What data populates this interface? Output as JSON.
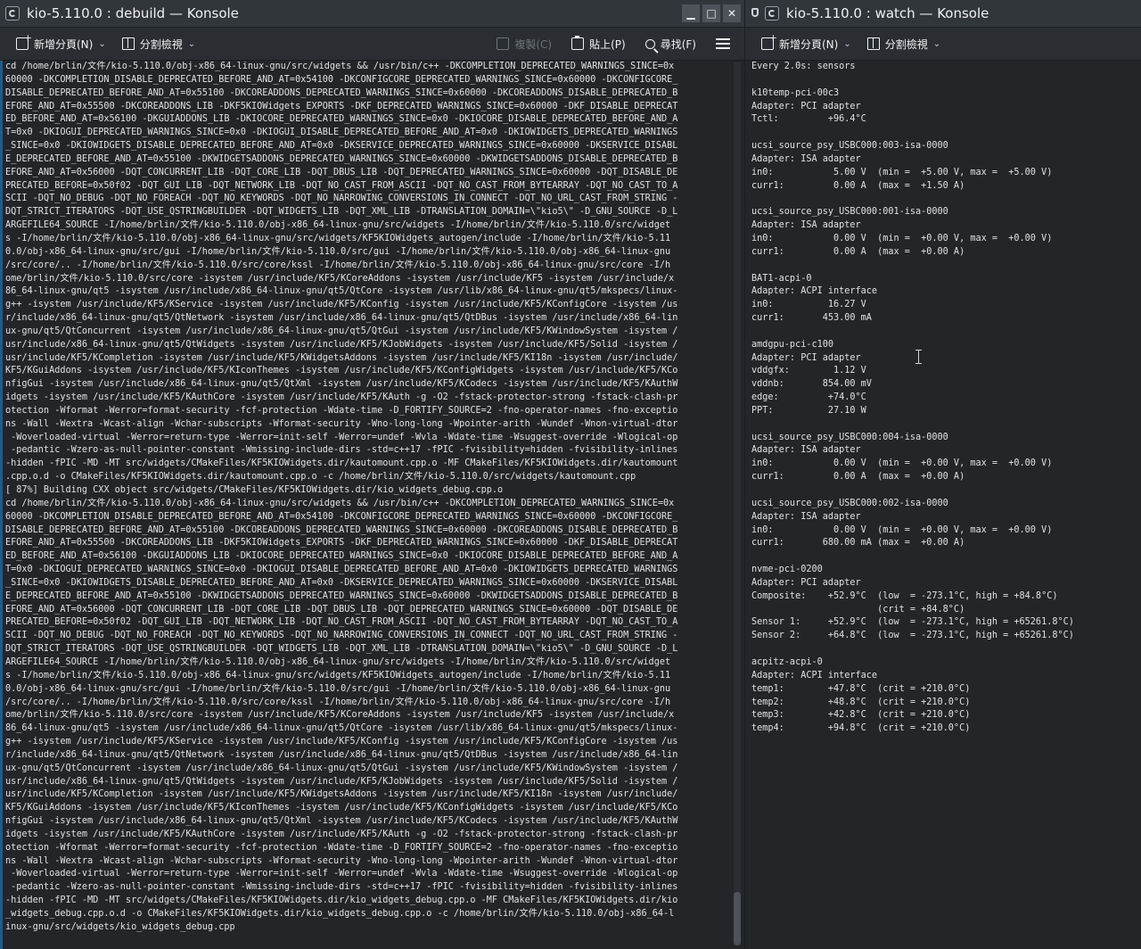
{
  "left_window": {
    "title": "kio-5.110.0 : debuild — Konsole",
    "buttons": {
      "minimize": "▁",
      "maximize": "□",
      "close": "✕"
    },
    "toolbar": {
      "new_tab": "新增分頁(N)",
      "split_view": "分割檢視",
      "copy": "複製(C)",
      "paste": "貼上(P)",
      "find": "尋找(F)"
    },
    "lines": [
      "cd /home/brlin/文件/kio-5.110.0/obj-x86_64-linux-gnu/src/widgets && /usr/bin/c++ -DKCOMPLETION_DEPRECATED_WARNINGS_SINCE=0x",
      "60000 -DKCOMPLETION_DISABLE_DEPRECATED_BEFORE_AND_AT=0x54100 -DKCONFIGCORE_DEPRECATED_WARNINGS_SINCE=0x60000 -DKCONFIGCORE_",
      "DISABLE_DEPRECATED_BEFORE_AND_AT=0x55100 -DKCOREADDONS_DEPRECATED_WARNINGS_SINCE=0x60000 -DKCOREADDONS_DISABLE_DEPRECATED_B",
      "EFORE_AND_AT=0x55500 -DKCOREADDONS_LIB -DKF5KIOWidgets_EXPORTS -DKF_DEPRECATED_WARNINGS_SINCE=0x60000 -DKF_DISABLE_DEPRECAT",
      "ED_BEFORE_AND_AT=0x56100 -DKGUIADDONS_LIB -DKIOCORE_DEPRECATED_WARNINGS_SINCE=0x0 -DKIOCORE_DISABLE_DEPRECATED_BEFORE_AND_A",
      "T=0x0 -DKIOGUI_DEPRECATED_WARNINGS_SINCE=0x0 -DKIOGUI_DISABLE_DEPRECATED_BEFORE_AND_AT=0x0 -DKIOWIDGETS_DEPRECATED_WARNINGS",
      "_SINCE=0x0 -DKIOWIDGETS_DISABLE_DEPRECATED_BEFORE_AND_AT=0x0 -DKSERVICE_DEPRECATED_WARNINGS_SINCE=0x60000 -DKSERVICE_DISABL",
      "E_DEPRECATED_BEFORE_AND_AT=0x55100 -DKWIDGETSADDONS_DEPRECATED_WARNINGS_SINCE=0x60000 -DKWIDGETSADDONS_DISABLE_DEPRECATED_B",
      "EFORE_AND_AT=0x56000 -DQT_CONCURRENT_LIB -DQT_CORE_LIB -DQT_DBUS_LIB -DQT_DEPRECATED_WARNINGS_SINCE=0x60000 -DQT_DISABLE_DE",
      "PRECATED_BEFORE=0x50f02 -DQT_GUI_LIB -DQT_NETWORK_LIB -DQT_NO_CAST_FROM_ASCII -DQT_NO_CAST_FROM_BYTEARRAY -DQT_NO_CAST_TO_A",
      "SCII -DQT_NO_DEBUG -DQT_NO_FOREACH -DQT_NO_KEYWORDS -DQT_NO_NARROWING_CONVERSIONS_IN_CONNECT -DQT_NO_URL_CAST_FROM_STRING -",
      "DQT_STRICT_ITERATORS -DQT_USE_QSTRINGBUILDER -DQT_WIDGETS_LIB -DQT_XML_LIB -DTRANSLATION_DOMAIN=\\\"kio5\\\" -D_GNU_SOURCE -D_L",
      "ARGEFILE64_SOURCE -I/home/brlin/文件/kio-5.110.0/obj-x86_64-linux-gnu/src/widgets -I/home/brlin/文件/kio-5.110.0/src/widget",
      "s -I/home/brlin/文件/kio-5.110.0/obj-x86_64-linux-gnu/src/widgets/KF5KIOWidgets_autogen/include -I/home/brlin/文件/kio-5.11",
      "0.0/obj-x86_64-linux-gnu/src/gui -I/home/brlin/文件/kio-5.110.0/src/gui -I/home/brlin/文件/kio-5.110.0/obj-x86_64-linux-gnu",
      "/src/core/.. -I/home/brlin/文件/kio-5.110.0/src/core/kssl -I/home/brlin/文件/kio-5.110.0/obj-x86_64-linux-gnu/src/core -I/h",
      "ome/brlin/文件/kio-5.110.0/src/core -isystem /usr/include/KF5/KCoreAddons -isystem /usr/include/KF5 -isystem /usr/include/x",
      "86_64-linux-gnu/qt5 -isystem /usr/include/x86_64-linux-gnu/qt5/QtCore -isystem /usr/lib/x86_64-linux-gnu/qt5/mkspecs/linux-",
      "g++ -isystem /usr/include/KF5/KService -isystem /usr/include/KF5/KConfig -isystem /usr/include/KF5/KConfigCore -isystem /us",
      "r/include/x86_64-linux-gnu/qt5/QtNetwork -isystem /usr/include/x86_64-linux-gnu/qt5/QtDBus -isystem /usr/include/x86_64-lin",
      "ux-gnu/qt5/QtConcurrent -isystem /usr/include/x86_64-linux-gnu/qt5/QtGui -isystem /usr/include/KF5/KWindowSystem -isystem /",
      "usr/include/x86_64-linux-gnu/qt5/QtWidgets -isystem /usr/include/KF5/KJobWidgets -isystem /usr/include/KF5/Solid -isystem /",
      "usr/include/KF5/KCompletion -isystem /usr/include/KF5/KWidgetsAddons -isystem /usr/include/KF5/KI18n -isystem /usr/include/",
      "KF5/KGuiAddons -isystem /usr/include/KF5/KIconThemes -isystem /usr/include/KF5/KConfigWidgets -isystem /usr/include/KF5/KCo",
      "nfigGui -isystem /usr/include/x86_64-linux-gnu/qt5/QtXml -isystem /usr/include/KF5/KCodecs -isystem /usr/include/KF5/KAuthW",
      "idgets -isystem /usr/include/KF5/KAuthCore -isystem /usr/include/KF5/KAuth -g -O2 -fstack-protector-strong -fstack-clash-pr",
      "otection -Wformat -Werror=format-security -fcf-protection -Wdate-time -D_FORTIFY_SOURCE=2 -fno-operator-names -fno-exceptio",
      "ns -Wall -Wextra -Wcast-align -Wchar-subscripts -Wformat-security -Wno-long-long -Wpointer-arith -Wundef -Wnon-virtual-dtor",
      " -Woverloaded-virtual -Werror=return-type -Werror=init-self -Werror=undef -Wvla -Wdate-time -Wsuggest-override -Wlogical-op",
      " -pedantic -Wzero-as-null-pointer-constant -Wmissing-include-dirs -std=c++17 -fPIC -fvisibility=hidden -fvisibility-inlines",
      "-hidden -fPIC -MD -MT src/widgets/CMakeFiles/KF5KIOWidgets.dir/kautomount.cpp.o -MF CMakeFiles/KF5KIOWidgets.dir/kautomount",
      ".cpp.o.d -o CMakeFiles/KF5KIOWidgets.dir/kautomount.cpp.o -c /home/brlin/文件/kio-5.110.0/src/widgets/kautomount.cpp",
      "[ 87%] Building CXX object src/widgets/CMakeFiles/KF5KIOWidgets.dir/kio_widgets_debug.cpp.o",
      "cd /home/brlin/文件/kio-5.110.0/obj-x86_64-linux-gnu/src/widgets && /usr/bin/c++ -DKCOMPLETION_DEPRECATED_WARNINGS_SINCE=0x",
      "60000 -DKCOMPLETION_DISABLE_DEPRECATED_BEFORE_AND_AT=0x54100 -DKCONFIGCORE_DEPRECATED_WARNINGS_SINCE=0x60000 -DKCONFIGCORE_",
      "DISABLE_DEPRECATED_BEFORE_AND_AT=0x55100 -DKCOREADDONS_DEPRECATED_WARNINGS_SINCE=0x60000 -DKCOREADDONS_DISABLE_DEPRECATED_B",
      "EFORE_AND_AT=0x55500 -DKCOREADDONS_LIB -DKF5KIOWidgets_EXPORTS -DKF_DEPRECATED_WARNINGS_SINCE=0x60000 -DKF_DISABLE_DEPRECAT",
      "ED_BEFORE_AND_AT=0x56100 -DKGUIADDONS_LIB -DKIOCORE_DEPRECATED_WARNINGS_SINCE=0x0 -DKIOCORE_DISABLE_DEPRECATED_BEFORE_AND_A",
      "T=0x0 -DKIOGUI_DEPRECATED_WARNINGS_SINCE=0x0 -DKIOGUI_DISABLE_DEPRECATED_BEFORE_AND_AT=0x0 -DKIOWIDGETS_DEPRECATED_WARNINGS",
      "_SINCE=0x0 -DKIOWIDGETS_DISABLE_DEPRECATED_BEFORE_AND_AT=0x0 -DKSERVICE_DEPRECATED_WARNINGS_SINCE=0x60000 -DKSERVICE_DISABL",
      "E_DEPRECATED_BEFORE_AND_AT=0x55100 -DKWIDGETSADDONS_DEPRECATED_WARNINGS_SINCE=0x60000 -DKWIDGETSADDONS_DISABLE_DEPRECATED_B",
      "EFORE_AND_AT=0x56000 -DQT_CONCURRENT_LIB -DQT_CORE_LIB -DQT_DBUS_LIB -DQT_DEPRECATED_WARNINGS_SINCE=0x60000 -DQT_DISABLE_DE",
      "PRECATED_BEFORE=0x50f02 -DQT_GUI_LIB -DQT_NETWORK_LIB -DQT_NO_CAST_FROM_ASCII -DQT_NO_CAST_FROM_BYTEARRAY -DQT_NO_CAST_TO_A",
      "SCII -DQT_NO_DEBUG -DQT_NO_FOREACH -DQT_NO_KEYWORDS -DQT_NO_NARROWING_CONVERSIONS_IN_CONNECT -DQT_NO_URL_CAST_FROM_STRING -",
      "DQT_STRICT_ITERATORS -DQT_USE_QSTRINGBUILDER -DQT_WIDGETS_LIB -DQT_XML_LIB -DTRANSLATION_DOMAIN=\\\"kio5\\\" -D_GNU_SOURCE -D_L",
      "ARGEFILE64_SOURCE -I/home/brlin/文件/kio-5.110.0/obj-x86_64-linux-gnu/src/widgets -I/home/brlin/文件/kio-5.110.0/src/widget",
      "s -I/home/brlin/文件/kio-5.110.0/obj-x86_64-linux-gnu/src/widgets/KF5KIOWidgets_autogen/include -I/home/brlin/文件/kio-5.11",
      "0.0/obj-x86_64-linux-gnu/src/gui -I/home/brlin/文件/kio-5.110.0/src/gui -I/home/brlin/文件/kio-5.110.0/obj-x86_64-linux-gnu",
      "/src/core/.. -I/home/brlin/文件/kio-5.110.0/src/core/kssl -I/home/brlin/文件/kio-5.110.0/obj-x86_64-linux-gnu/src/core -I/h",
      "ome/brlin/文件/kio-5.110.0/src/core -isystem /usr/include/KF5/KCoreAddons -isystem /usr/include/KF5 -isystem /usr/include/x",
      "86_64-linux-gnu/qt5 -isystem /usr/include/x86_64-linux-gnu/qt5/QtCore -isystem /usr/lib/x86_64-linux-gnu/qt5/mkspecs/linux-",
      "g++ -isystem /usr/include/KF5/KService -isystem /usr/include/KF5/KConfig -isystem /usr/include/KF5/KConfigCore -isystem /us",
      "r/include/x86_64-linux-gnu/qt5/QtNetwork -isystem /usr/include/x86_64-linux-gnu/qt5/QtDBus -isystem /usr/include/x86_64-lin",
      "ux-gnu/qt5/QtConcurrent -isystem /usr/include/x86_64-linux-gnu/qt5/QtGui -isystem /usr/include/KF5/KWindowSystem -isystem /",
      "usr/include/x86_64-linux-gnu/qt5/QtWidgets -isystem /usr/include/KF5/KJobWidgets -isystem /usr/include/KF5/Solid -isystem /",
      "usr/include/KF5/KCompletion -isystem /usr/include/KF5/KWidgetsAddons -isystem /usr/include/KF5/KI18n -isystem /usr/include/",
      "KF5/KGuiAddons -isystem /usr/include/KF5/KIconThemes -isystem /usr/include/KF5/KConfigWidgets -isystem /usr/include/KF5/KCo",
      "nfigGui -isystem /usr/include/x86_64-linux-gnu/qt5/QtXml -isystem /usr/include/KF5/KCodecs -isystem /usr/include/KF5/KAuthW",
      "idgets -isystem /usr/include/KF5/KAuthCore -isystem /usr/include/KF5/KAuth -g -O2 -fstack-protector-strong -fstack-clash-pr",
      "otection -Wformat -Werror=format-security -fcf-protection -Wdate-time -D_FORTIFY_SOURCE=2 -fno-operator-names -fno-exceptio",
      "ns -Wall -Wextra -Wcast-align -Wchar-subscripts -Wformat-security -Wno-long-long -Wpointer-arith -Wundef -Wnon-virtual-dtor",
      " -Woverloaded-virtual -Werror=return-type -Werror=init-self -Werror=undef -Wvla -Wdate-time -Wsuggest-override -Wlogical-op",
      " -pedantic -Wzero-as-null-pointer-constant -Wmissing-include-dirs -std=c++17 -fPIC -fvisibility=hidden -fvisibility-inlines",
      "-hidden -fPIC -MD -MT src/widgets/CMakeFiles/KF5KIOWidgets.dir/kio_widgets_debug.cpp.o -MF CMakeFiles/KF5KIOWidgets.dir/kio",
      "_widgets_debug.cpp.o.d -o CMakeFiles/KF5KIOWidgets.dir/kio_widgets_debug.cpp.o -c /home/brlin/文件/kio-5.110.0/obj-x86_64-l",
      "inux-gnu/src/widgets/kio_widgets_debug.cpp"
    ]
  },
  "right_window": {
    "title": "kio-5.110.0 : watch — Konsole",
    "toolbar": {
      "new_tab": "新增分頁(N)",
      "split_view": "分割檢視"
    },
    "lines": [
      "Every 2.0s: sensors",
      "",
      "k10temp-pci-00c3",
      "Adapter: PCI adapter",
      "Tctl:         +96.4°C",
      "",
      "ucsi_source_psy_USBC000:003-isa-0000",
      "Adapter: ISA adapter",
      "in0:           5.00 V  (min =  +5.00 V, max =  +5.00 V)",
      "curr1:         0.00 A  (max =  +1.50 A)",
      "",
      "ucsi_source_psy_USBC000:001-isa-0000",
      "Adapter: ISA adapter",
      "in0:           0.00 V  (min =  +0.00 V, max =  +0.00 V)",
      "curr1:         0.00 A  (max =  +0.00 A)",
      "",
      "BAT1-acpi-0",
      "Adapter: ACPI interface",
      "in0:          16.27 V",
      "curr1:       453.00 mA",
      "",
      "amdgpu-pci-c100",
      "Adapter: PCI adapter",
      "vddgfx:        1.12 V",
      "vddnb:       854.00 mV",
      "edge:         +74.0°C",
      "PPT:          27.10 W",
      "",
      "ucsi_source_psy_USBC000:004-isa-0000",
      "Adapter: ISA adapter",
      "in0:           0.00 V  (min =  +0.00 V, max =  +0.00 V)",
      "curr1:         0.00 A  (max =  +0.00 A)",
      "",
      "ucsi_source_psy_USBC000:002-isa-0000",
      "Adapter: ISA adapter",
      "in0:           0.00 V  (min =  +0.00 V, max =  +0.00 V)",
      "curr1:       680.00 mA (max =  +0.00 A)",
      "",
      "nvme-pci-0200",
      "Adapter: PCI adapter",
      "Composite:    +52.9°C  (low  = -273.1°C, high = +84.8°C)",
      "                       (crit = +84.8°C)",
      "Sensor 1:     +52.9°C  (low  = -273.1°C, high = +65261.8°C)",
      "Sensor 2:     +64.8°C  (low  = -273.1°C, high = +65261.8°C)",
      "",
      "acpitz-acpi-0",
      "Adapter: ACPI interface",
      "temp1:        +47.8°C  (crit = +210.0°C)",
      "temp2:        +48.8°C  (crit = +210.0°C)",
      "temp3:        +42.8°C  (crit = +210.0°C)",
      "temp4:        +94.8°C  (crit = +210.0°C)"
    ]
  },
  "colors": {
    "terminal_bg": "#232629",
    "terminal_fg": "#dfe2e4",
    "titlebar_bg": "#31363b",
    "toolbar_bg": "#2a2e32",
    "accent": "#1d5d8a"
  }
}
